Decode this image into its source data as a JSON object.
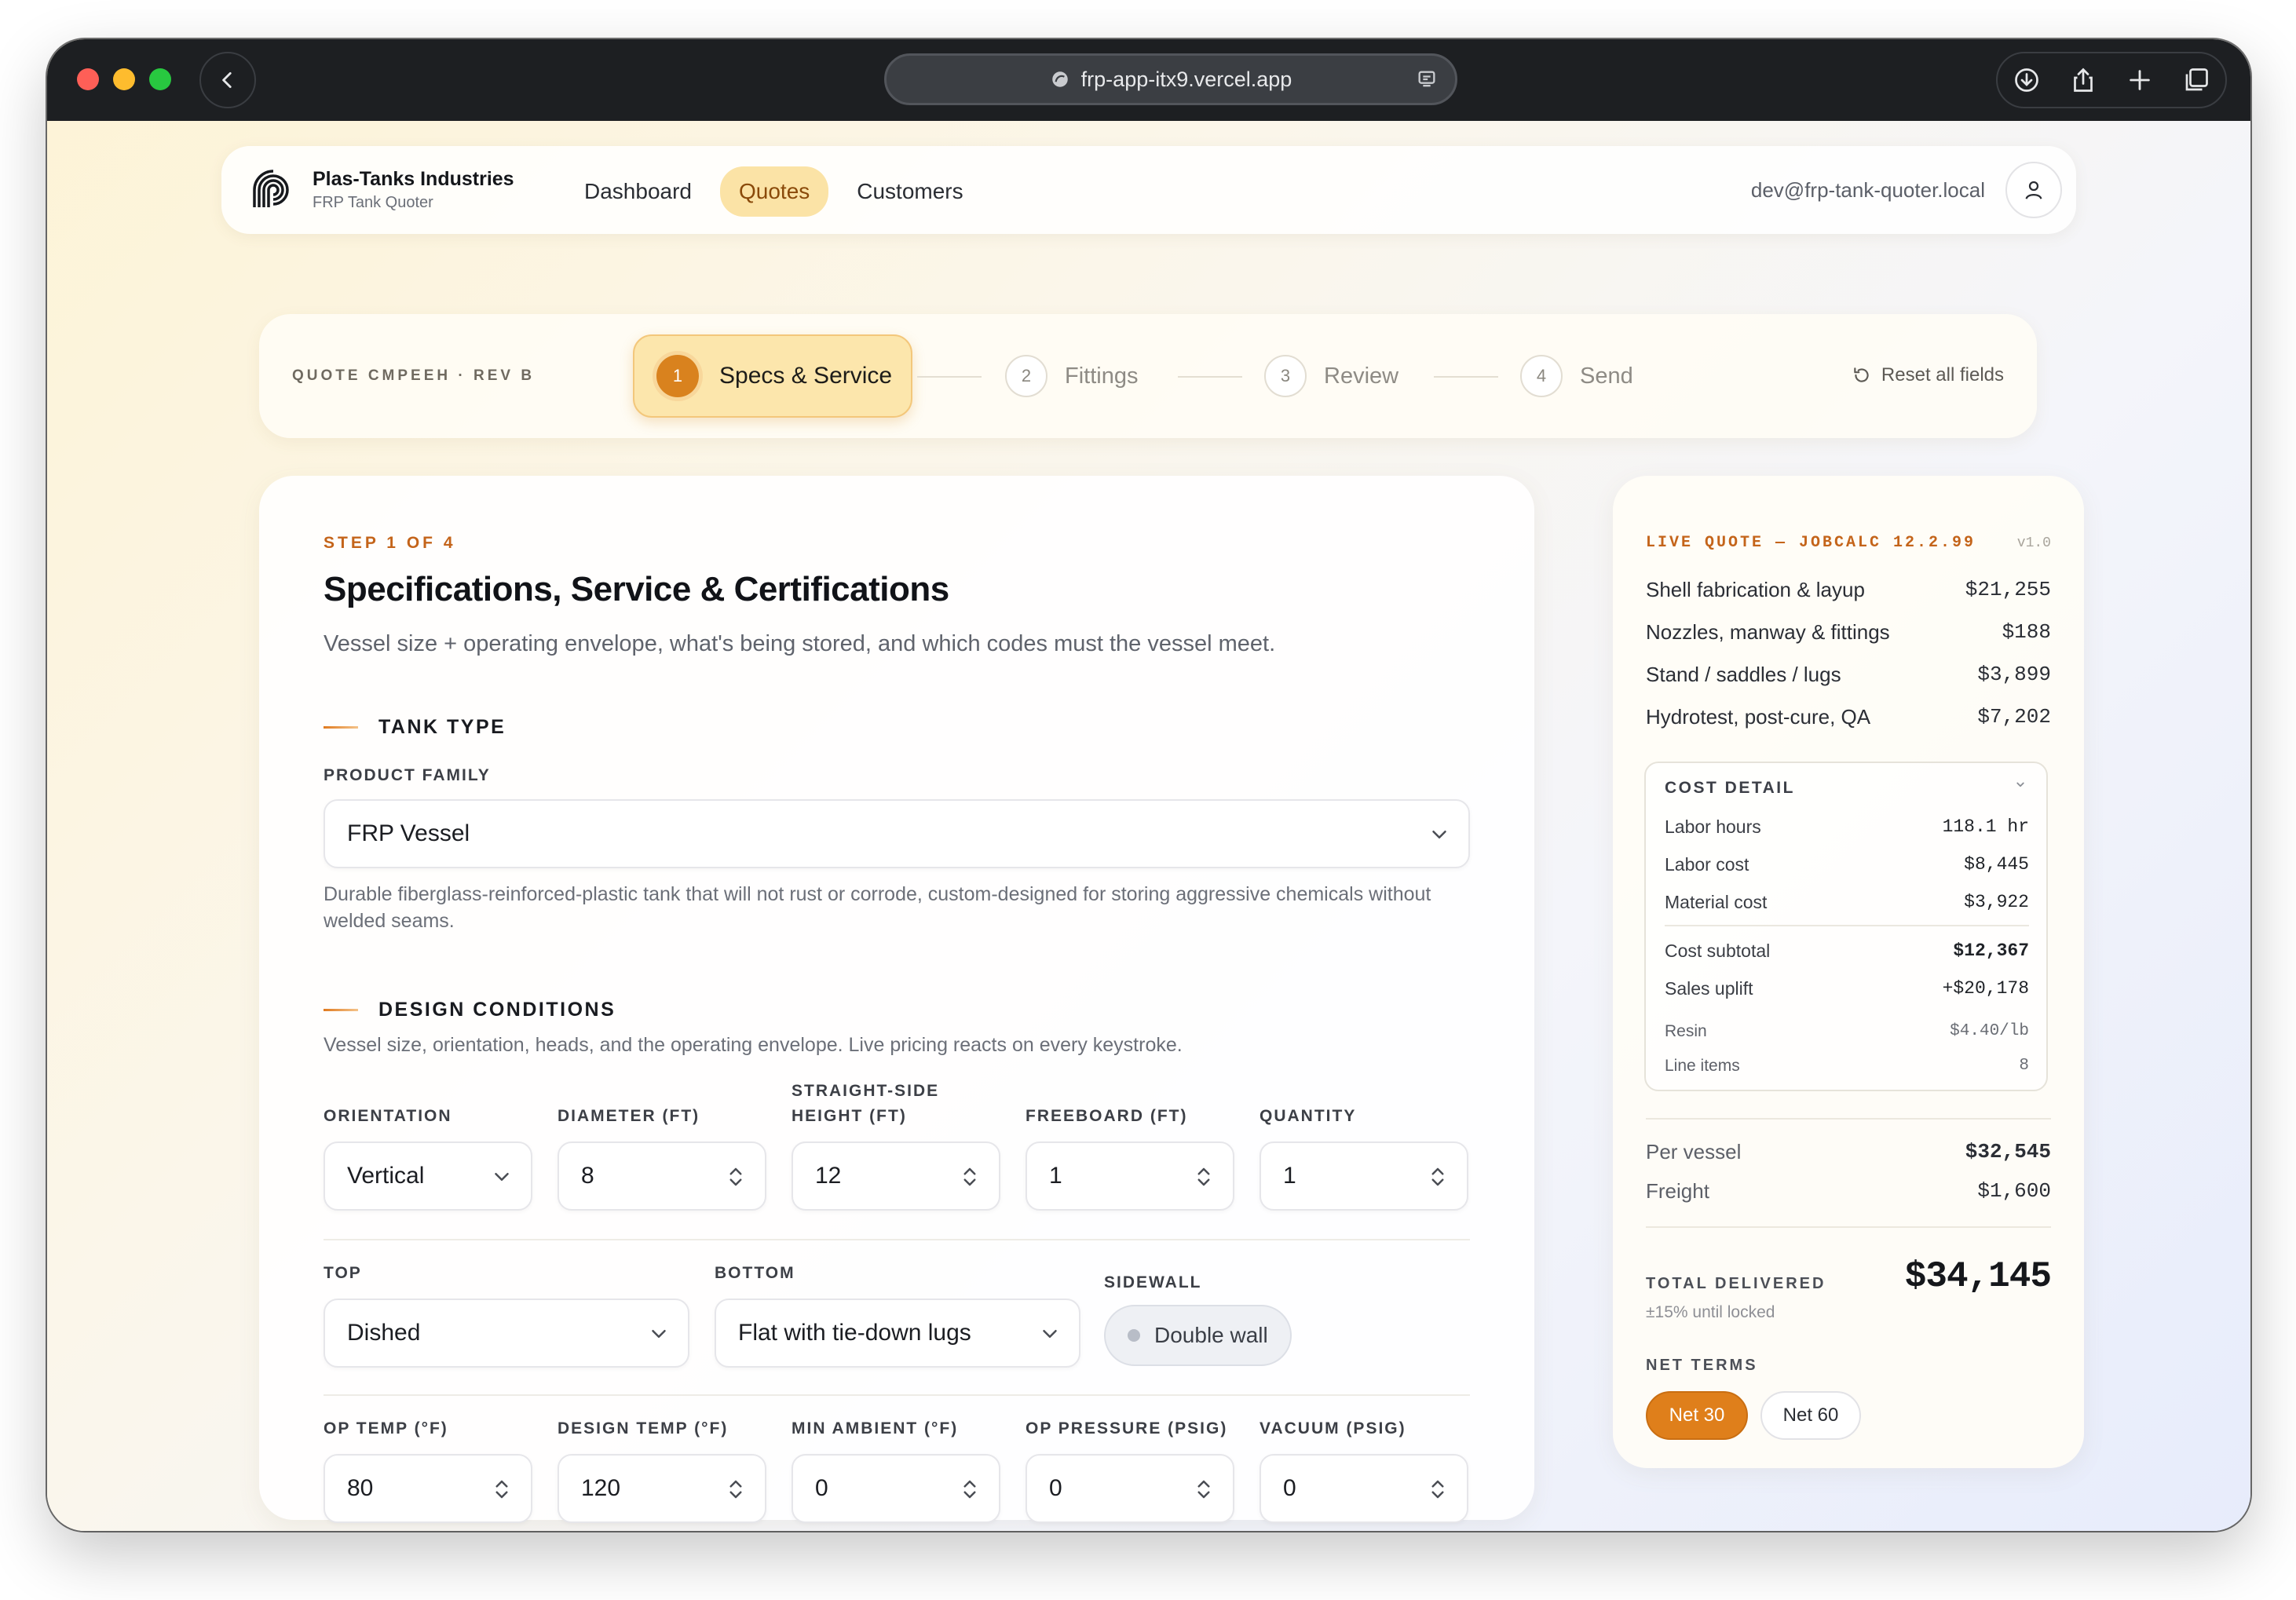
{
  "browser": {
    "url": "frp-app-itx9.vercel.app"
  },
  "nav": {
    "brand_name": "Plas-Tanks Industries",
    "brand_sub": "FRP Tank Quoter",
    "links": [
      {
        "label": "Dashboard"
      },
      {
        "label": "Quotes"
      },
      {
        "label": "Customers"
      }
    ],
    "active_link": "Quotes",
    "user_email": "dev@frp-tank-quoter.local"
  },
  "stepper": {
    "quote_id": "QUOTE CMPEEH · REV B",
    "steps": [
      {
        "num": "1",
        "label": "Specs & Service"
      },
      {
        "num": "2",
        "label": "Fittings"
      },
      {
        "num": "3",
        "label": "Review"
      },
      {
        "num": "4",
        "label": "Send"
      }
    ],
    "reset_label": "Reset all fields"
  },
  "form": {
    "eyebrow": "STEP 1 OF 4",
    "title": "Specifications, Service & Certifications",
    "lede": "Vessel size + operating envelope, what's being stored, and which codes must the vessel meet.",
    "tank_type": {
      "heading": "TANK TYPE",
      "product_family_label": "PRODUCT FAMILY",
      "product_family_value": "FRP Vessel",
      "help": "Durable fiberglass-reinforced-plastic tank that will not rust or corrode, custom-designed for storing aggressive chemicals without welded seams."
    },
    "design": {
      "heading": "DESIGN CONDITIONS",
      "help": "Vessel size, orientation, heads, and the operating envelope. Live pricing reacts on every keystroke.",
      "orientation_label": "ORIENTATION",
      "orientation_value": "Vertical",
      "diameter_label": "DIAMETER (FT)",
      "diameter_value": "8",
      "height_label_1": "STRAIGHT-SIDE",
      "height_label_2": "HEIGHT (FT)",
      "height_value": "12",
      "freeboard_label": "FREEBOARD (FT)",
      "freeboard_value": "1",
      "quantity_label": "QUANTITY",
      "quantity_value": "1",
      "top_label": "TOP",
      "top_value": "Dished",
      "bottom_label": "BOTTOM",
      "bottom_value": "Flat with tie-down lugs",
      "sidewall_label": "SIDEWALL",
      "sidewall_value": "Double wall",
      "op_temp_label": "OP TEMP (°F)",
      "op_temp_value": "80",
      "design_temp_label": "DESIGN TEMP (°F)",
      "design_temp_value": "120",
      "min_ambient_label": "MIN AMBIENT (°F)",
      "min_ambient_value": "0",
      "op_pressure_label": "OP PRESSURE (PSIG)",
      "op_pressure_value": "0",
      "vacuum_label": "VACUUM (PSIG)",
      "vacuum_value": "0"
    }
  },
  "quote": {
    "eyebrow": "LIVE QUOTE — JOBCALC 12.2.99",
    "version": "v1.0",
    "lines": [
      {
        "label": "Shell fabrication & layup",
        "value": "$21,255"
      },
      {
        "label": "Nozzles, manway & fittings",
        "value": "$188"
      },
      {
        "label": "Stand / saddles / lugs",
        "value": "$3,899"
      },
      {
        "label": "Hydrotest, post-cure, QA",
        "value": "$7,202"
      }
    ],
    "detail": {
      "title": "COST DETAIL",
      "rows": [
        {
          "label": "Labor hours",
          "value": "118.1 hr"
        },
        {
          "label": "Labor cost",
          "value": "$8,445"
        },
        {
          "label": "Material cost",
          "value": "$3,922"
        },
        {
          "label": "Cost subtotal",
          "value": "$12,367"
        },
        {
          "label": "Sales uplift",
          "value": "+$20,178"
        },
        {
          "label": "Resin",
          "value": "$4.40/lb"
        },
        {
          "label": "Line items",
          "value": "8"
        }
      ]
    },
    "per_vessel_label": "Per vessel",
    "per_vessel_value": "$32,545",
    "freight_label": "Freight",
    "freight_value": "$1,600",
    "total_label": "TOTAL DELIVERED",
    "total_sub": "±15% until locked",
    "total_value": "$34,145",
    "terms_label": "NET TERMS",
    "terms": [
      {
        "label": "Net 30"
      },
      {
        "label": "Net 60"
      }
    ],
    "active_term": "Net 30"
  },
  "colors": {
    "accent": "#df7f1b",
    "active_tab_bg": "#fbe3a6"
  }
}
